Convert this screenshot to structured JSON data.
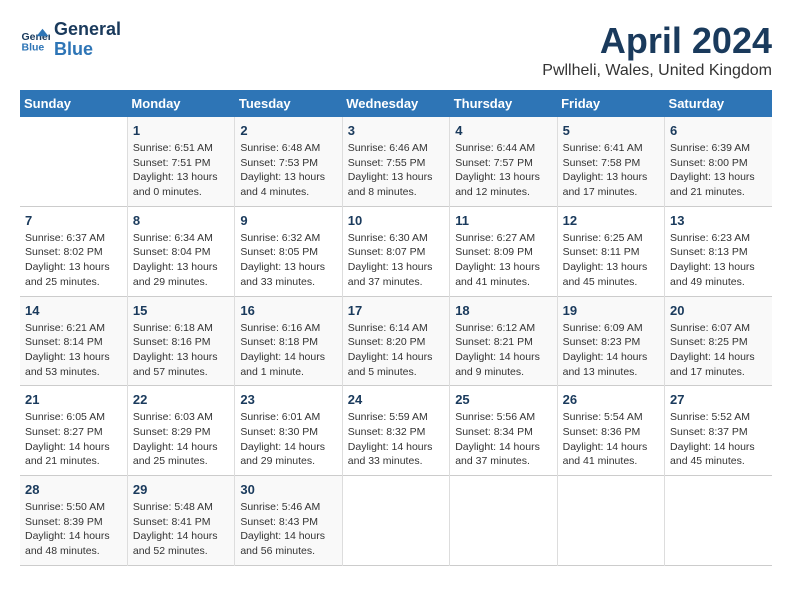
{
  "logo": {
    "line1": "General",
    "line2": "Blue"
  },
  "title": "April 2024",
  "subtitle": "Pwllheli, Wales, United Kingdom",
  "weekdays": [
    "Sunday",
    "Monday",
    "Tuesday",
    "Wednesday",
    "Thursday",
    "Friday",
    "Saturday"
  ],
  "weeks": [
    [
      {
        "day": "",
        "info": ""
      },
      {
        "day": "1",
        "info": "Sunrise: 6:51 AM\nSunset: 7:51 PM\nDaylight: 13 hours\nand 0 minutes."
      },
      {
        "day": "2",
        "info": "Sunrise: 6:48 AM\nSunset: 7:53 PM\nDaylight: 13 hours\nand 4 minutes."
      },
      {
        "day": "3",
        "info": "Sunrise: 6:46 AM\nSunset: 7:55 PM\nDaylight: 13 hours\nand 8 minutes."
      },
      {
        "day": "4",
        "info": "Sunrise: 6:44 AM\nSunset: 7:57 PM\nDaylight: 13 hours\nand 12 minutes."
      },
      {
        "day": "5",
        "info": "Sunrise: 6:41 AM\nSunset: 7:58 PM\nDaylight: 13 hours\nand 17 minutes."
      },
      {
        "day": "6",
        "info": "Sunrise: 6:39 AM\nSunset: 8:00 PM\nDaylight: 13 hours\nand 21 minutes."
      }
    ],
    [
      {
        "day": "7",
        "info": "Sunrise: 6:37 AM\nSunset: 8:02 PM\nDaylight: 13 hours\nand 25 minutes."
      },
      {
        "day": "8",
        "info": "Sunrise: 6:34 AM\nSunset: 8:04 PM\nDaylight: 13 hours\nand 29 minutes."
      },
      {
        "day": "9",
        "info": "Sunrise: 6:32 AM\nSunset: 8:05 PM\nDaylight: 13 hours\nand 33 minutes."
      },
      {
        "day": "10",
        "info": "Sunrise: 6:30 AM\nSunset: 8:07 PM\nDaylight: 13 hours\nand 37 minutes."
      },
      {
        "day": "11",
        "info": "Sunrise: 6:27 AM\nSunset: 8:09 PM\nDaylight: 13 hours\nand 41 minutes."
      },
      {
        "day": "12",
        "info": "Sunrise: 6:25 AM\nSunset: 8:11 PM\nDaylight: 13 hours\nand 45 minutes."
      },
      {
        "day": "13",
        "info": "Sunrise: 6:23 AM\nSunset: 8:13 PM\nDaylight: 13 hours\nand 49 minutes."
      }
    ],
    [
      {
        "day": "14",
        "info": "Sunrise: 6:21 AM\nSunset: 8:14 PM\nDaylight: 13 hours\nand 53 minutes."
      },
      {
        "day": "15",
        "info": "Sunrise: 6:18 AM\nSunset: 8:16 PM\nDaylight: 13 hours\nand 57 minutes."
      },
      {
        "day": "16",
        "info": "Sunrise: 6:16 AM\nSunset: 8:18 PM\nDaylight: 14 hours\nand 1 minute."
      },
      {
        "day": "17",
        "info": "Sunrise: 6:14 AM\nSunset: 8:20 PM\nDaylight: 14 hours\nand 5 minutes."
      },
      {
        "day": "18",
        "info": "Sunrise: 6:12 AM\nSunset: 8:21 PM\nDaylight: 14 hours\nand 9 minutes."
      },
      {
        "day": "19",
        "info": "Sunrise: 6:09 AM\nSunset: 8:23 PM\nDaylight: 14 hours\nand 13 minutes."
      },
      {
        "day": "20",
        "info": "Sunrise: 6:07 AM\nSunset: 8:25 PM\nDaylight: 14 hours\nand 17 minutes."
      }
    ],
    [
      {
        "day": "21",
        "info": "Sunrise: 6:05 AM\nSunset: 8:27 PM\nDaylight: 14 hours\nand 21 minutes."
      },
      {
        "day": "22",
        "info": "Sunrise: 6:03 AM\nSunset: 8:29 PM\nDaylight: 14 hours\nand 25 minutes."
      },
      {
        "day": "23",
        "info": "Sunrise: 6:01 AM\nSunset: 8:30 PM\nDaylight: 14 hours\nand 29 minutes."
      },
      {
        "day": "24",
        "info": "Sunrise: 5:59 AM\nSunset: 8:32 PM\nDaylight: 14 hours\nand 33 minutes."
      },
      {
        "day": "25",
        "info": "Sunrise: 5:56 AM\nSunset: 8:34 PM\nDaylight: 14 hours\nand 37 minutes."
      },
      {
        "day": "26",
        "info": "Sunrise: 5:54 AM\nSunset: 8:36 PM\nDaylight: 14 hours\nand 41 minutes."
      },
      {
        "day": "27",
        "info": "Sunrise: 5:52 AM\nSunset: 8:37 PM\nDaylight: 14 hours\nand 45 minutes."
      }
    ],
    [
      {
        "day": "28",
        "info": "Sunrise: 5:50 AM\nSunset: 8:39 PM\nDaylight: 14 hours\nand 48 minutes."
      },
      {
        "day": "29",
        "info": "Sunrise: 5:48 AM\nSunset: 8:41 PM\nDaylight: 14 hours\nand 52 minutes."
      },
      {
        "day": "30",
        "info": "Sunrise: 5:46 AM\nSunset: 8:43 PM\nDaylight: 14 hours\nand 56 minutes."
      },
      {
        "day": "",
        "info": ""
      },
      {
        "day": "",
        "info": ""
      },
      {
        "day": "",
        "info": ""
      },
      {
        "day": "",
        "info": ""
      }
    ]
  ]
}
